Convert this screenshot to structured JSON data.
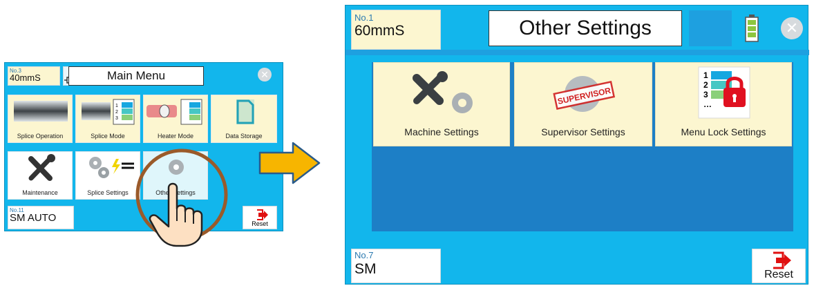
{
  "left": {
    "profile": {
      "no": "No.3",
      "mode": "40mmS"
    },
    "title": "Main Menu",
    "tiles": [
      {
        "label": "Splice Operation",
        "icon": "splice-operation-icon"
      },
      {
        "label": "Splice Mode",
        "icon": "splice-mode-icon"
      },
      {
        "label": "Heater Mode",
        "icon": "heater-mode-icon"
      },
      {
        "label": "Data Storage",
        "icon": "data-storage-icon"
      },
      {
        "label": "Maintenance",
        "icon": "tools-icon"
      },
      {
        "label": "Splice Settings",
        "icon": "splice-settings-icon"
      },
      {
        "label": "Other Settings",
        "icon": "gear-icon"
      }
    ],
    "bottom": {
      "no": "No.11",
      "mode": "SM AUTO"
    },
    "reset_label": "Reset"
  },
  "right": {
    "profile": {
      "no": "No.1",
      "mode": "60mmS"
    },
    "title": "Other Settings",
    "tiles": [
      {
        "label": "Machine Settings",
        "icon": "tools-gear-icon"
      },
      {
        "label": "Supervisor Settings",
        "icon": "supervisor-stamp-icon",
        "stamp_text": "SUPERVISOR"
      },
      {
        "label": "Menu Lock Settings",
        "icon": "lock-list-icon"
      }
    ],
    "bottom": {
      "no": "No.7",
      "mode": "SM"
    },
    "reset_label": "Reset"
  },
  "colors": {
    "screen_bg": "#12b6ec",
    "tile_bg": "#fcf6d0",
    "main_panel": "#1d7fc6",
    "arrow_fill": "#f7b500",
    "arrow_stroke": "#2a5b8a",
    "highlight_circle": "#9a5a2a",
    "battery": "#8dc63f",
    "reset_red": "#e01010"
  }
}
